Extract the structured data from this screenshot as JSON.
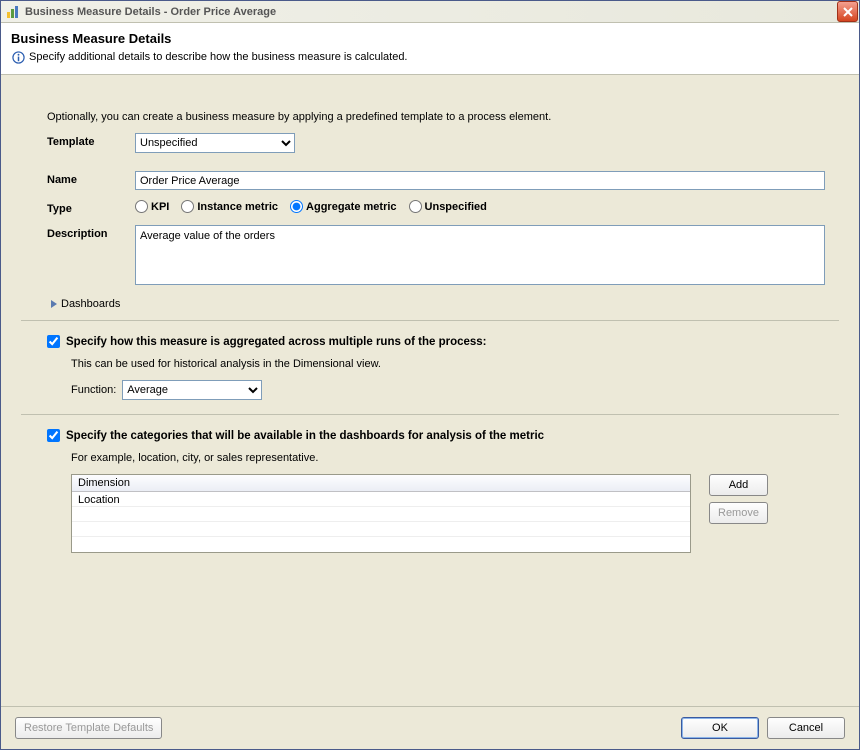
{
  "window": {
    "title": "Business Measure Details - Order Price Average"
  },
  "header": {
    "title": "Business Measure Details",
    "description": "Specify additional details to describe how the business measure is calculated."
  },
  "form": {
    "note": "Optionally, you can create a business measure by applying a predefined template to a process element.",
    "template_label": "Template",
    "template_value": "Unspecified",
    "name_label": "Name",
    "name_value": "Order Price Average",
    "type_label": "Type",
    "type_options": {
      "kpi": "KPI",
      "instance": "Instance metric",
      "aggregate": "Aggregate metric",
      "unspecified": "Unspecified"
    },
    "type_selected": "aggregate",
    "description_label": "Description",
    "description_value": "Average value of the orders",
    "dashboards_label": "Dashboards"
  },
  "aggregate_section": {
    "checked": true,
    "title": "Specify how this measure is aggregated across multiple runs of the process:",
    "note": "This can be used for historical analysis in the Dimensional view.",
    "function_label": "Function:",
    "function_value": "Average"
  },
  "categories_section": {
    "checked": true,
    "title": "Specify the categories that will be available in the dashboards for analysis of the metric",
    "note": "For example, location, city, or sales representative.",
    "column_header": "Dimension",
    "rows": [
      "Location"
    ],
    "add_label": "Add",
    "remove_label": "Remove"
  },
  "footer": {
    "restore": "Restore Template Defaults",
    "ok": "OK",
    "cancel": "Cancel"
  }
}
